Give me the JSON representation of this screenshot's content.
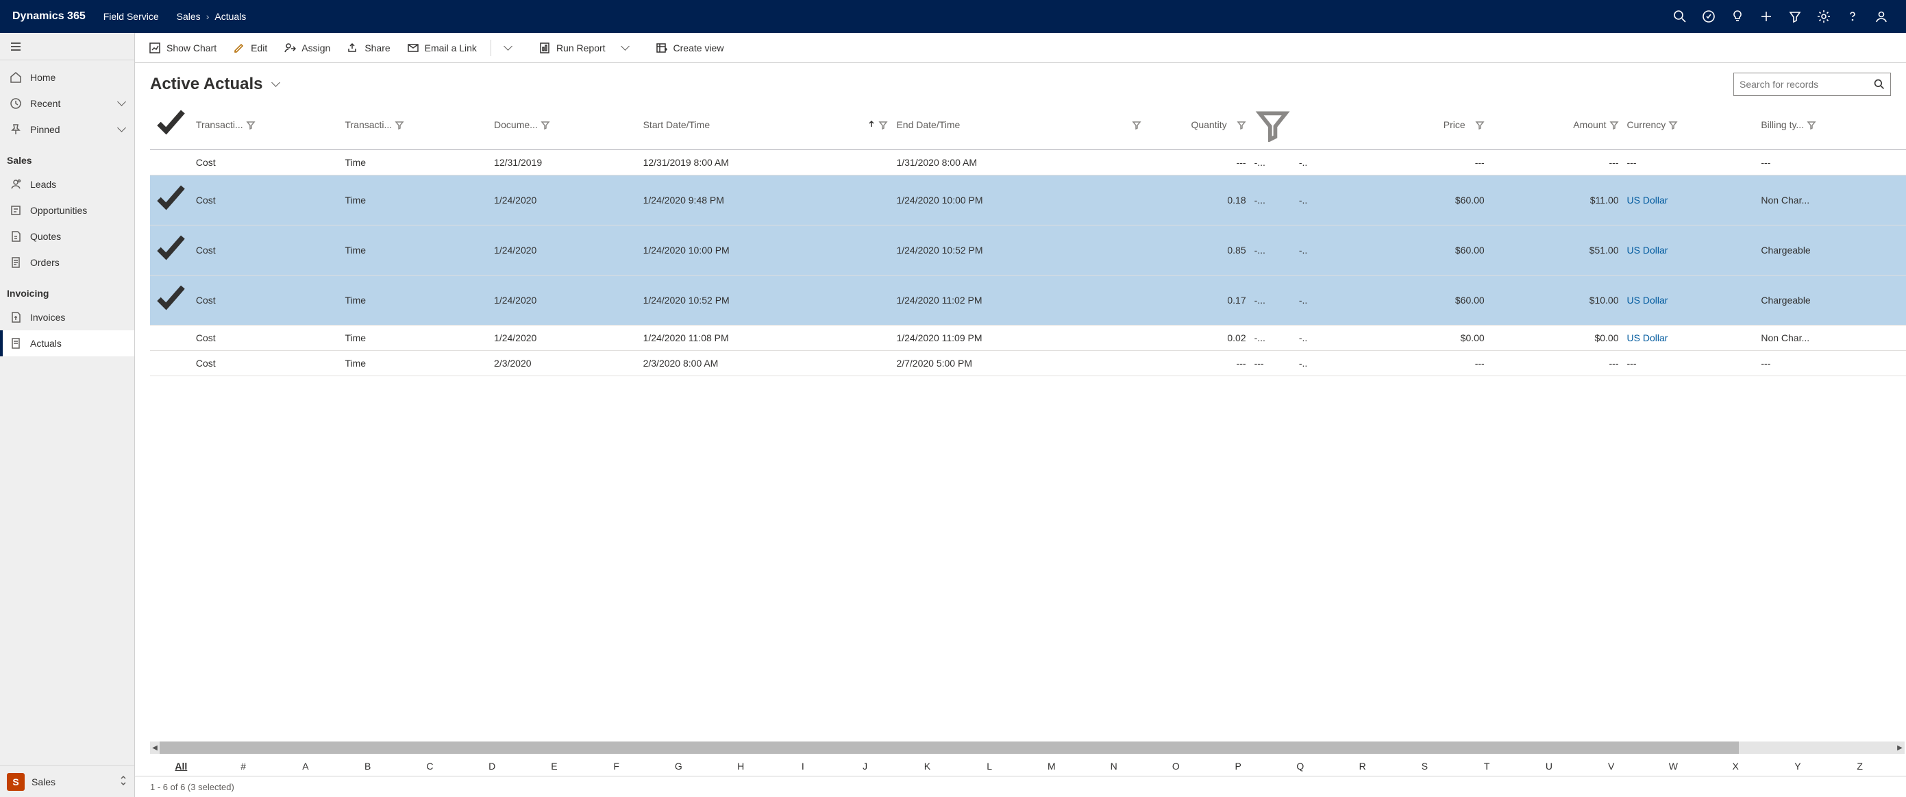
{
  "topbar": {
    "brand": "Dynamics 365",
    "app": "Field Service",
    "crumb1": "Sales",
    "crumb2": "Actuals"
  },
  "sidebar": {
    "home": "Home",
    "recent": "Recent",
    "pinned": "Pinned",
    "section_sales": "Sales",
    "leads": "Leads",
    "opportunities": "Opportunities",
    "quotes": "Quotes",
    "orders": "Orders",
    "section_invoicing": "Invoicing",
    "invoices": "Invoices",
    "actuals": "Actuals",
    "bottom_letter": "S",
    "bottom_label": "Sales"
  },
  "commands": {
    "show_chart": "Show Chart",
    "edit": "Edit",
    "assign": "Assign",
    "share": "Share",
    "email_link": "Email a Link",
    "run_report": "Run Report",
    "create_view": "Create view"
  },
  "view": {
    "title": "Active Actuals",
    "search_placeholder": "Search for records"
  },
  "columns": {
    "c0": "Transacti...",
    "c1": "Transacti...",
    "c2": "Docume...",
    "c3": "Start Date/Time",
    "c4": "End Date/Time",
    "c5": "Quantity",
    "c6": "Price",
    "c7": "Amount",
    "c8": "Currency",
    "c9": "Billing ty..."
  },
  "rows": [
    {
      "sel": false,
      "c0": "Cost",
      "c1": "Time",
      "c2": "12/31/2019",
      "c3": "12/31/2019 8:00 AM",
      "c4": "1/31/2020 8:00 AM",
      "c5": "---",
      "c5b": "-...",
      "c5c": "-..",
      "c6": "---",
      "c7": "---",
      "c8": "---",
      "c9": "---"
    },
    {
      "sel": true,
      "c0": "Cost",
      "c1": "Time",
      "c2": "1/24/2020",
      "c3": "1/24/2020 9:48 PM",
      "c4": "1/24/2020 10:00 PM",
      "c5": "0.18",
      "c5b": "-...",
      "c5c": "-..",
      "c6": "$60.00",
      "c7": "$11.00",
      "c8": "US Dollar",
      "c9": "Non Char..."
    },
    {
      "sel": true,
      "c0": "Cost",
      "c1": "Time",
      "c2": "1/24/2020",
      "c3": "1/24/2020 10:00 PM",
      "c4": "1/24/2020 10:52 PM",
      "c5": "0.85",
      "c5b": "-...",
      "c5c": "-..",
      "c6": "$60.00",
      "c7": "$51.00",
      "c8": "US Dollar",
      "c9": "Chargeable"
    },
    {
      "sel": true,
      "c0": "Cost",
      "c1": "Time",
      "c2": "1/24/2020",
      "c3": "1/24/2020 10:52 PM",
      "c4": "1/24/2020 11:02 PM",
      "c5": "0.17",
      "c5b": "-...",
      "c5c": "-..",
      "c6": "$60.00",
      "c7": "$10.00",
      "c8": "US Dollar",
      "c9": "Chargeable"
    },
    {
      "sel": false,
      "c0": "Cost",
      "c1": "Time",
      "c2": "1/24/2020",
      "c3": "1/24/2020 11:08 PM",
      "c4": "1/24/2020 11:09 PM",
      "c5": "0.02",
      "c5b": "-...",
      "c5c": "-..",
      "c6": "$0.00",
      "c7": "$0.00",
      "c8": "US Dollar",
      "c9": "Non Char..."
    },
    {
      "sel": false,
      "c0": "Cost",
      "c1": "Time",
      "c2": "2/3/2020",
      "c3": "2/3/2020 8:00 AM",
      "c4": "2/7/2020 5:00 PM",
      "c5": "---",
      "c5b": "---",
      "c5c": "-..",
      "c6": "---",
      "c7": "---",
      "c8": "---",
      "c9": "---"
    }
  ],
  "jumpbar": [
    "All",
    "#",
    "A",
    "B",
    "C",
    "D",
    "E",
    "F",
    "G",
    "H",
    "I",
    "J",
    "K",
    "L",
    "M",
    "N",
    "O",
    "P",
    "Q",
    "R",
    "S",
    "T",
    "U",
    "V",
    "W",
    "X",
    "Y",
    "Z"
  ],
  "status": "1 - 6 of 6 (3 selected)"
}
